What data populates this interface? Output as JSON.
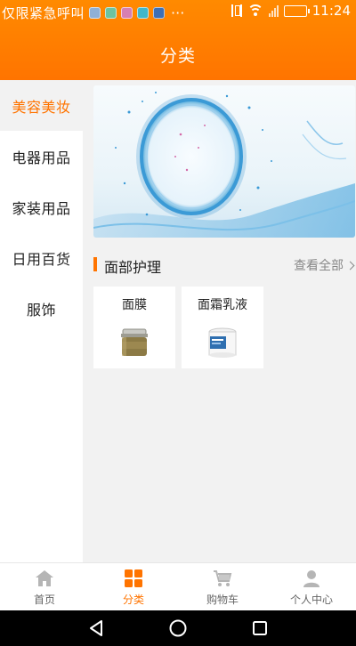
{
  "status_bar": {
    "carrier": "仅限紧急呼叫",
    "dots": "···",
    "time": "11:24"
  },
  "header": {
    "title": "分类"
  },
  "sidebar": {
    "items": [
      {
        "label": "美容美妆",
        "active": true
      },
      {
        "label": "电器用品",
        "active": false
      },
      {
        "label": "家装用品",
        "active": false
      },
      {
        "label": "日用百货",
        "active": false
      },
      {
        "label": "服饰",
        "active": false
      }
    ]
  },
  "section": {
    "title": "面部护理",
    "view_all": "查看全部"
  },
  "products": [
    {
      "name": "面膜",
      "icon": "jar-icon"
    },
    {
      "name": "面霜乳液",
      "icon": "cream-tub-icon"
    }
  ],
  "tabbar": {
    "tabs": [
      {
        "label": "首页",
        "icon": "home-icon",
        "active": false
      },
      {
        "label": "分类",
        "icon": "grid-icon",
        "active": true
      },
      {
        "label": "购物车",
        "icon": "cart-icon",
        "active": false
      },
      {
        "label": "个人中心",
        "icon": "user-icon",
        "active": false
      }
    ]
  },
  "colors": {
    "accent": "#ff7400",
    "sidebar_active_bg": "#f2f2f2",
    "content_bg": "#f2f2f2"
  }
}
